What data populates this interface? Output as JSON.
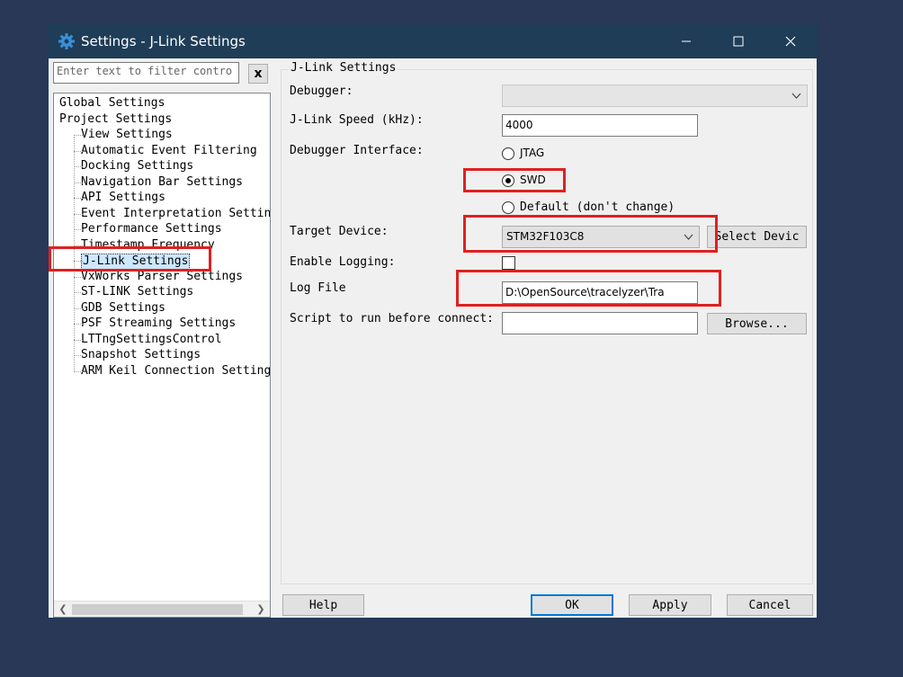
{
  "window": {
    "title": "Settings - J-Link Settings",
    "app_icon": "gear-icon",
    "accent_color": "#1f3d57"
  },
  "filter": {
    "placeholder": "Enter text to filter contro",
    "clear_label": "x"
  },
  "tree": {
    "items": [
      {
        "label": "Global Settings"
      },
      {
        "label": "Project Settings"
      },
      {
        "label": "View Settings"
      },
      {
        "label": "Automatic Event Filtering"
      },
      {
        "label": "Docking Settings"
      },
      {
        "label": "Navigation Bar Settings"
      },
      {
        "label": "API Settings"
      },
      {
        "label": "Event Interpretation Setting"
      },
      {
        "label": "Performance Settings"
      },
      {
        "label": "Timestamp Frequency"
      },
      {
        "label": "J-Link Settings",
        "selected": true
      },
      {
        "label": "VxWorks Parser Settings"
      },
      {
        "label": "ST-LINK Settings"
      },
      {
        "label": "GDB Settings"
      },
      {
        "label": "PSF Streaming Settings"
      },
      {
        "label": "LTTngSettingsControl"
      },
      {
        "label": "Snapshot Settings"
      },
      {
        "label": "ARM Keil Connection Settings"
      }
    ]
  },
  "panel": {
    "group_title": "J-Link Settings",
    "debugger_label": "Debugger:",
    "debugger_value": "",
    "speed_label": "J-Link Speed (kHz):",
    "speed_value": "4000",
    "interface_label": "Debugger Interface:",
    "interface_options": [
      "JTAG",
      "SWD",
      "Default (don't change)"
    ],
    "interface_selected": "SWD",
    "target_label": "Target Device:",
    "target_value": "STM32F103C8",
    "select_device_label": "Select Devic",
    "logging_label": "Enable Logging:",
    "logging_checked": false,
    "logfile_label": "Log File",
    "logfile_value": "D:\\OpenSource\\tracelyzer\\Tra",
    "script_label": "Script to run before connect:",
    "script_value": "",
    "browse_label": "Browse..."
  },
  "footer": {
    "help_label": "Help",
    "ok_label": "OK",
    "apply_label": "Apply",
    "cancel_label": "Cancel"
  },
  "highlight_color": "#e02020"
}
